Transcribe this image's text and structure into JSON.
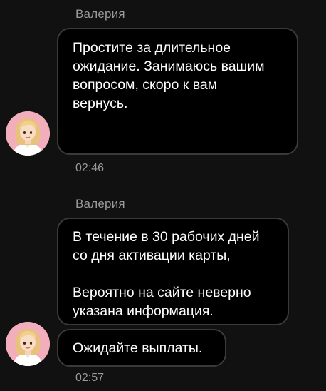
{
  "messages": [
    {
      "sender": "Валерия",
      "bubbles": [
        {
          "lines": [
            "Простите за длительное",
            "ожидание. Занимаюсь вашим",
            "вопросом, скоро к вам",
            "вернусь."
          ]
        }
      ],
      "time": "02:46"
    },
    {
      "sender": "Валерия",
      "bubbles": [
        {
          "lines": [
            "В течение в 30 рабочих дней",
            "со дня активации карты,",
            "",
            "Вероятно на сайте неверно",
            "указана информация."
          ]
        },
        {
          "lines": [
            "Ожидайте выплаты."
          ]
        }
      ],
      "time": "02:57"
    }
  ],
  "colors": {
    "background": "#111111",
    "bubble_bg": "#000000",
    "bubble_border": "#3a3a3a",
    "meta_text": "#9a9a9a",
    "avatar_bg": "#f2aebb"
  },
  "icons": {
    "avatar": "operator-avatar-icon"
  }
}
